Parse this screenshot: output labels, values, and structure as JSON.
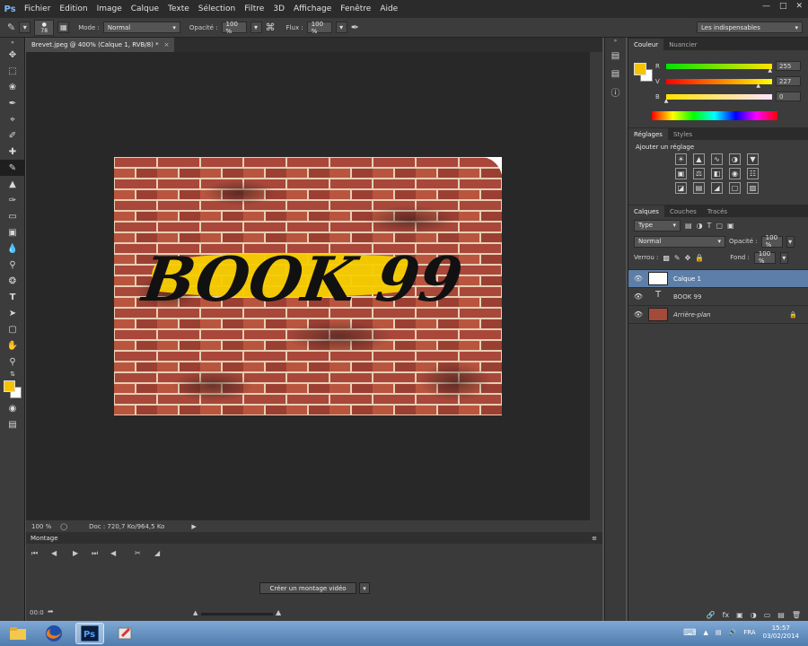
{
  "menu": {
    "app_logo": "Ps",
    "items": [
      "Fichier",
      "Edition",
      "Image",
      "Calque",
      "Texte",
      "Sélection",
      "Filtre",
      "3D",
      "Affichage",
      "Fenêtre",
      "Aide"
    ]
  },
  "options": {
    "brush_size": "78",
    "mode_label": "Mode :",
    "mode_value": "Normal",
    "opacity_label": "Opacité :",
    "opacity_value": "100 %",
    "flow_label": "Flux :",
    "flow_value": "100 %",
    "workspace": "Les indispensables"
  },
  "document": {
    "tab_title": "Brevet.jpeg @ 400% (Calque 1, RVB/8) *",
    "graffiti_text": "BOOK 99",
    "zoom": "100 %",
    "doc_info": "Doc : 720,7 Ko/964,5 Ko"
  },
  "timeline": {
    "title": "Montage",
    "create_button": "Créer un montage vidéo",
    "time": "00:0"
  },
  "color_panel": {
    "tabs": [
      "Couleur",
      "Nuancier"
    ],
    "foreground": "#f5c400",
    "channels": [
      {
        "label": "R",
        "value": "255",
        "pos": 0.98
      },
      {
        "label": "V",
        "value": "227",
        "pos": 0.87
      },
      {
        "label": "B",
        "value": "0",
        "pos": 0.0
      }
    ]
  },
  "adjust_panel": {
    "tabs": [
      "Réglages",
      "Styles"
    ],
    "title": "Ajouter un réglage"
  },
  "layers_panel": {
    "tabs": [
      "Calques",
      "Couches",
      "Tracés"
    ],
    "filter": "Type",
    "blend": "Normal",
    "opacity_label": "Opacité :",
    "opacity_value": "100 %",
    "lock_label": "Verrou :",
    "fill_label": "Fond :",
    "fill_value": "100 %",
    "layers": [
      {
        "name": "Calque 1",
        "kind": "pixel",
        "selected": true
      },
      {
        "name": "BOOK 99",
        "kind": "text",
        "selected": false
      },
      {
        "name": "Arrière-plan",
        "kind": "background",
        "selected": false
      }
    ]
  },
  "taskbar": {
    "language": "FRA",
    "time": "15:57",
    "date": "03/02/2014"
  }
}
